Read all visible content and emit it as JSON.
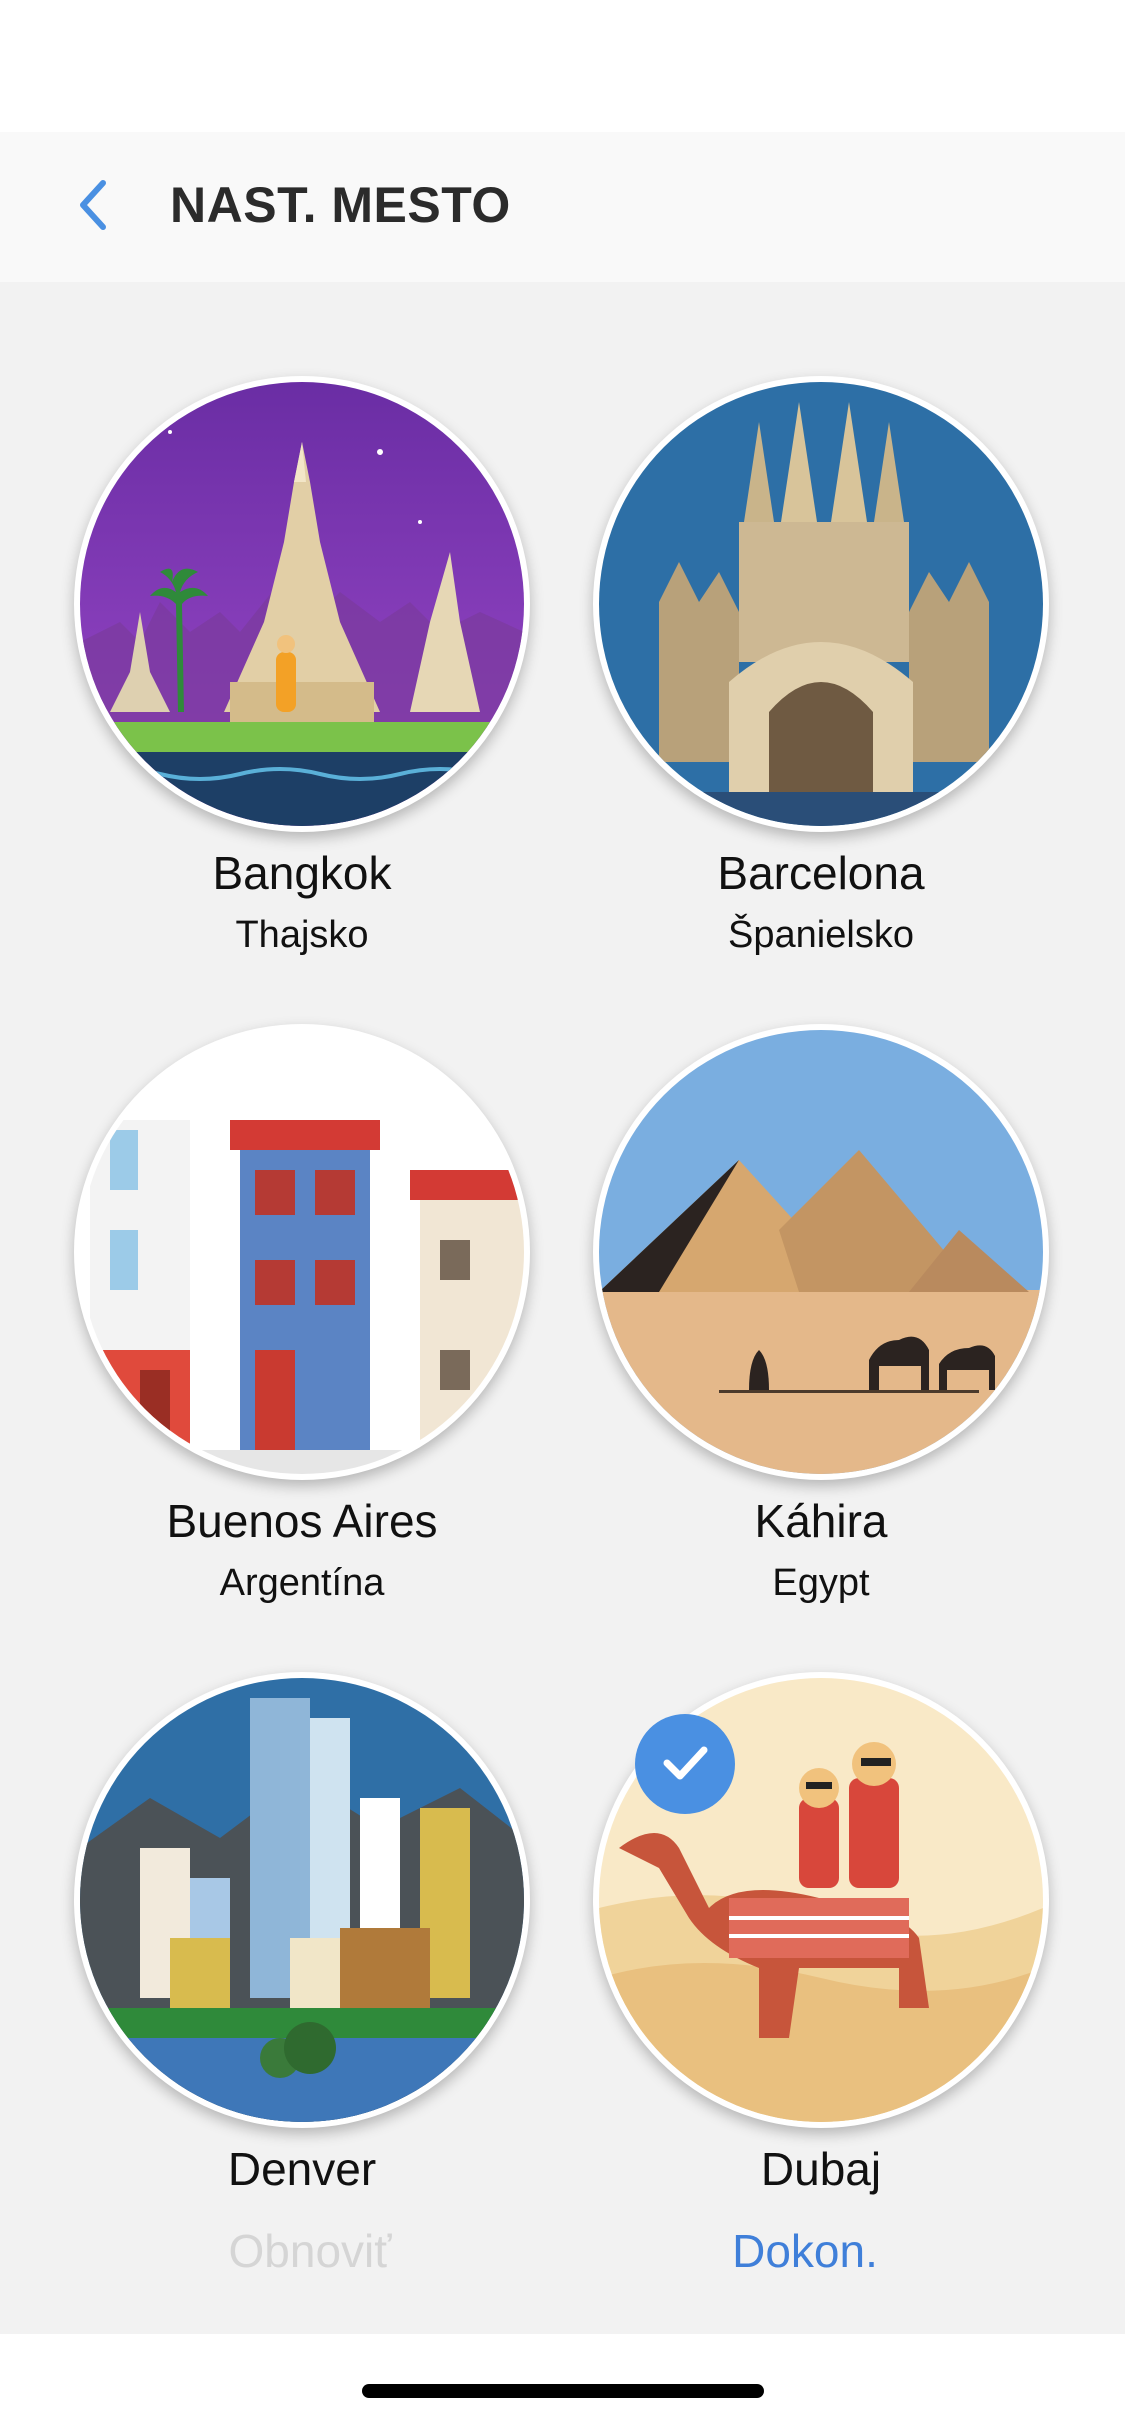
{
  "header": {
    "title": "NAST. MESTO",
    "back_icon": "chevron-left-icon",
    "accent": "#4a90e2"
  },
  "cities": [
    {
      "city": "Bangkok",
      "country": "Thajsko",
      "selected": false
    },
    {
      "city": "Barcelona",
      "country": "Španielsko",
      "selected": false
    },
    {
      "city": "Buenos Aires",
      "country": "Argentína",
      "selected": false
    },
    {
      "city": "Káhira",
      "country": "Egypt",
      "selected": false
    },
    {
      "city": "Denver",
      "country": "",
      "selected": false
    },
    {
      "city": "Dubaj",
      "country": "",
      "selected": true
    }
  ],
  "footer": {
    "reset_label": "Obnoviť",
    "done_label": "Dokon.",
    "done_color": "#3f7fd9"
  }
}
